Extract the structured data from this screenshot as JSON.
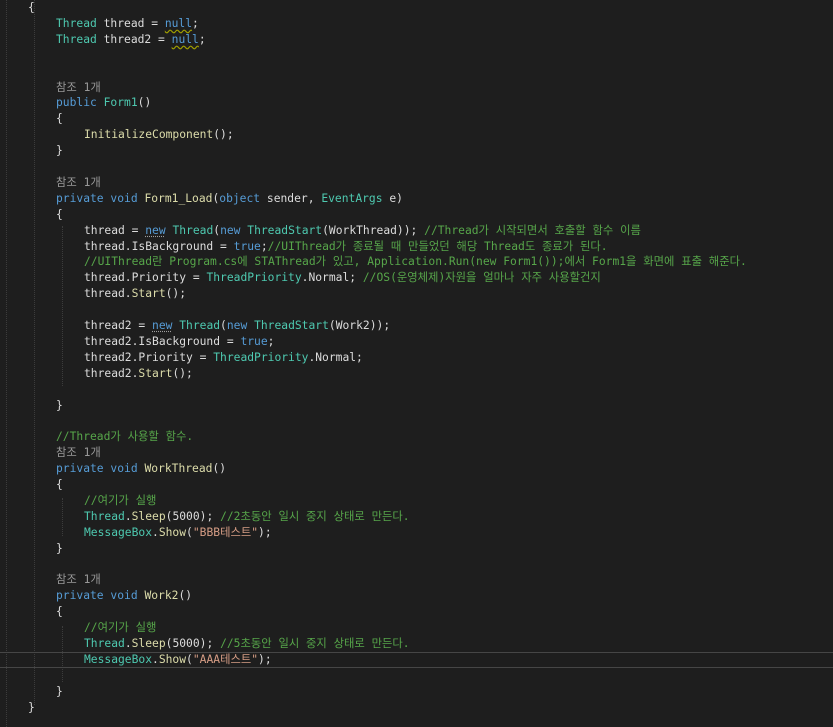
{
  "lines": [
    [
      {
        "t": "{",
        "c": "pl"
      }
    ],
    [
      {
        "t": "Thread",
        "c": "ty"
      },
      {
        "t": " thread = ",
        "c": "pl"
      },
      {
        "t": "null",
        "c": "kw sq"
      },
      {
        "t": ";",
        "c": "pl"
      }
    ],
    [
      {
        "t": "Thread",
        "c": "ty"
      },
      {
        "t": " thread2 = ",
        "c": "pl"
      },
      {
        "t": "null",
        "c": "kw sq"
      },
      {
        "t": ";",
        "c": "pl"
      }
    ],
    [],
    [],
    [
      {
        "t": "참조 1개",
        "c": "lens"
      }
    ],
    [
      {
        "t": "public",
        "c": "kw"
      },
      {
        "t": " ",
        "c": "pl"
      },
      {
        "t": "Form1",
        "c": "ty"
      },
      {
        "t": "()",
        "c": "pl"
      }
    ],
    [
      {
        "t": "{",
        "c": "pl"
      }
    ],
    [
      {
        "t": "InitializeComponent",
        "c": "fn"
      },
      {
        "t": "();",
        "c": "pl"
      }
    ],
    [
      {
        "t": "}",
        "c": "pl"
      }
    ],
    [],
    [
      {
        "t": "참조 1개",
        "c": "lens"
      }
    ],
    [
      {
        "t": "private",
        "c": "kw"
      },
      {
        "t": " ",
        "c": "pl"
      },
      {
        "t": "void",
        "c": "kw"
      },
      {
        "t": " ",
        "c": "pl"
      },
      {
        "t": "Form1_Load",
        "c": "fn"
      },
      {
        "t": "(",
        "c": "pl"
      },
      {
        "t": "object",
        "c": "kw"
      },
      {
        "t": " sender, ",
        "c": "pl"
      },
      {
        "t": "EventArgs",
        "c": "ty"
      },
      {
        "t": " e)",
        "c": "pl"
      }
    ],
    [
      {
        "t": "{",
        "c": "pl"
      }
    ],
    [
      {
        "t": "thread = ",
        "c": "pl"
      },
      {
        "t": "new",
        "c": "kw sq2"
      },
      {
        "t": " ",
        "c": "pl"
      },
      {
        "t": "Thread",
        "c": "ty"
      },
      {
        "t": "(",
        "c": "pl"
      },
      {
        "t": "new",
        "c": "kw"
      },
      {
        "t": " ",
        "c": "pl"
      },
      {
        "t": "ThreadStart",
        "c": "ty"
      },
      {
        "t": "(WorkThread)); ",
        "c": "pl"
      },
      {
        "t": "//Thread가 시작되면서 호출할 함수 이름",
        "c": "cm"
      }
    ],
    [
      {
        "t": "thread.IsBackground = ",
        "c": "pl"
      },
      {
        "t": "true",
        "c": "kw"
      },
      {
        "t": ";",
        "c": "pl"
      },
      {
        "t": "//UIThread가 종료될 때 만들었던 해당 Thread도 종료가 된다.",
        "c": "cm"
      }
    ],
    [
      {
        "t": "//UIThread란 Program.cs에 STAThread가 있고, Application.Run(new Form1());에서 Form1을 화면에 표출 해준다.",
        "c": "cm"
      }
    ],
    [
      {
        "t": "thread.Priority = ",
        "c": "pl"
      },
      {
        "t": "ThreadPriority",
        "c": "ty"
      },
      {
        "t": ".Normal; ",
        "c": "pl"
      },
      {
        "t": "//OS(운영체제)자원을 얼마나 자주 사용할건지",
        "c": "cm"
      }
    ],
    [
      {
        "t": "thread.",
        "c": "pl"
      },
      {
        "t": "Start",
        "c": "fn"
      },
      {
        "t": "();",
        "c": "pl"
      }
    ],
    [],
    [
      {
        "t": "thread2 = ",
        "c": "pl"
      },
      {
        "t": "new",
        "c": "kw sq2"
      },
      {
        "t": " ",
        "c": "pl"
      },
      {
        "t": "Thread",
        "c": "ty"
      },
      {
        "t": "(",
        "c": "pl"
      },
      {
        "t": "new",
        "c": "kw"
      },
      {
        "t": " ",
        "c": "pl"
      },
      {
        "t": "ThreadStart",
        "c": "ty"
      },
      {
        "t": "(Work2));",
        "c": "pl"
      }
    ],
    [
      {
        "t": "thread2.IsBackground = ",
        "c": "pl"
      },
      {
        "t": "true",
        "c": "kw"
      },
      {
        "t": ";",
        "c": "pl"
      }
    ],
    [
      {
        "t": "thread2.Priority = ",
        "c": "pl"
      },
      {
        "t": "ThreadPriority",
        "c": "ty"
      },
      {
        "t": ".Normal;",
        "c": "pl"
      }
    ],
    [
      {
        "t": "thread2.",
        "c": "pl"
      },
      {
        "t": "Start",
        "c": "fn"
      },
      {
        "t": "();",
        "c": "pl"
      }
    ],
    [],
    [
      {
        "t": "}",
        "c": "pl"
      }
    ],
    [],
    [
      {
        "t": "//Thread가 사용할 함수.",
        "c": "cm"
      }
    ],
    [
      {
        "t": "참조 1개",
        "c": "lens"
      }
    ],
    [
      {
        "t": "private",
        "c": "kw"
      },
      {
        "t": " ",
        "c": "pl"
      },
      {
        "t": "void",
        "c": "kw"
      },
      {
        "t": " ",
        "c": "pl"
      },
      {
        "t": "WorkThread",
        "c": "fn"
      },
      {
        "t": "()",
        "c": "pl"
      }
    ],
    [
      {
        "t": "{",
        "c": "pl"
      }
    ],
    [
      {
        "t": "//여기가 실행",
        "c": "cm"
      }
    ],
    [
      {
        "t": "Thread",
        "c": "ty"
      },
      {
        "t": ".",
        "c": "pl"
      },
      {
        "t": "Sleep",
        "c": "fn"
      },
      {
        "t": "(5000); ",
        "c": "pl"
      },
      {
        "t": "//2초동안 일시 중지 상태로 만든다.",
        "c": "cm"
      }
    ],
    [
      {
        "t": "MessageBox",
        "c": "ty"
      },
      {
        "t": ".",
        "c": "pl"
      },
      {
        "t": "Show",
        "c": "fn"
      },
      {
        "t": "(",
        "c": "pl"
      },
      {
        "t": "\"BBB테스트\"",
        "c": "st"
      },
      {
        "t": ");",
        "c": "pl"
      }
    ],
    [
      {
        "t": "}",
        "c": "pl"
      }
    ],
    [],
    [
      {
        "t": "참조 1개",
        "c": "lens"
      }
    ],
    [
      {
        "t": "private",
        "c": "kw"
      },
      {
        "t": " ",
        "c": "pl"
      },
      {
        "t": "void",
        "c": "kw"
      },
      {
        "t": " ",
        "c": "pl"
      },
      {
        "t": "Work2",
        "c": "fn"
      },
      {
        "t": "()",
        "c": "pl"
      }
    ],
    [
      {
        "t": "{",
        "c": "pl"
      }
    ],
    [
      {
        "t": "//여기가 실행",
        "c": "cm"
      }
    ],
    [
      {
        "t": "Thread",
        "c": "ty"
      },
      {
        "t": ".",
        "c": "pl"
      },
      {
        "t": "Sleep",
        "c": "fn"
      },
      {
        "t": "(5000); ",
        "c": "pl"
      },
      {
        "t": "//5초동안 일시 중지 상태로 만든다.",
        "c": "cm"
      }
    ],
    [
      {
        "t": "MessageBox",
        "c": "ty"
      },
      {
        "t": ".",
        "c": "pl"
      },
      {
        "t": "Show",
        "c": "fn"
      },
      {
        "t": "(",
        "c": "pl"
      },
      {
        "t": "\"AAA테스트\"",
        "c": "st"
      },
      {
        "t": ");",
        "c": "pl"
      }
    ],
    [],
    [
      {
        "t": "}",
        "c": "pl"
      }
    ],
    [
      {
        "t": "}",
        "c": "pl"
      }
    ]
  ],
  "colors": {
    "background": "#1e1e1e",
    "plain": "#dcdcdc",
    "keyword": "#569cd6",
    "type": "#4ec9b0",
    "method": "#dcdcaa",
    "comment": "#57a64a",
    "string": "#d69d85",
    "codelens": "#999999"
  }
}
